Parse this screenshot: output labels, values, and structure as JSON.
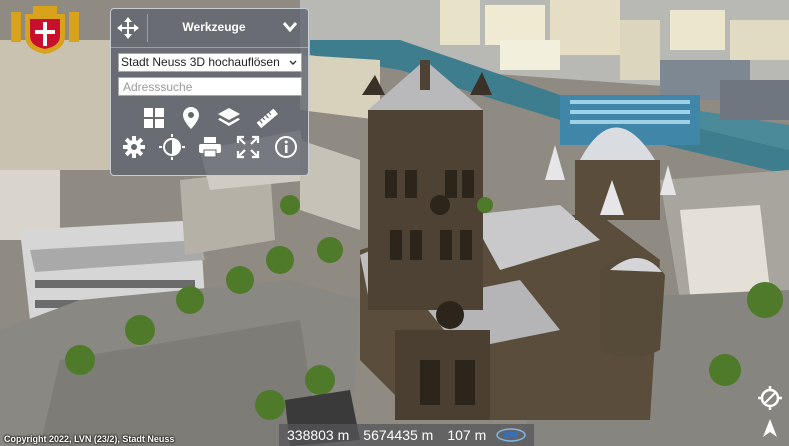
{
  "toolbox": {
    "title": "Werkzeuge",
    "layer_select": {
      "selected": "Stadt Neuss 3D hochauflösen"
    },
    "address_search": {
      "placeholder": "Adresssuche",
      "value": ""
    },
    "tools_row1": [
      "layout-icon",
      "map-marker-icon",
      "layers-icon",
      "measure-ruler-icon"
    ],
    "tools_row2": [
      "settings-gear-icon",
      "contrast-icon",
      "print-icon",
      "fullscreen-icon",
      "info-icon"
    ]
  },
  "status": {
    "copyright": "Copyright 2022, LVN (23/2), Stadt Neuss",
    "easting": "338803 m",
    "northing": "5674435 m",
    "height": "107 m"
  },
  "colors": {
    "panel": "#5f646e",
    "river": "#3e7d8e",
    "stone": "#5a4d3c",
    "roof": "#cfcfd2"
  }
}
